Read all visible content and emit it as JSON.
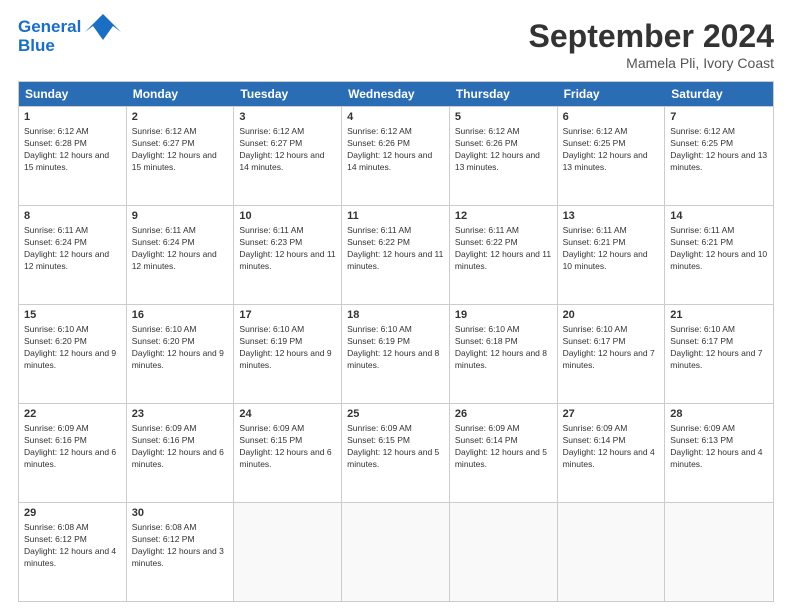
{
  "header": {
    "logo_line1": "General",
    "logo_line2": "Blue",
    "month": "September 2024",
    "location": "Mamela Pli, Ivory Coast"
  },
  "days_of_week": [
    "Sunday",
    "Monday",
    "Tuesday",
    "Wednesday",
    "Thursday",
    "Friday",
    "Saturday"
  ],
  "rows": [
    [
      {
        "day": "1",
        "rise": "6:12 AM",
        "set": "6:28 PM",
        "daylight": "12 hours and 15 minutes."
      },
      {
        "day": "2",
        "rise": "6:12 AM",
        "set": "6:27 PM",
        "daylight": "12 hours and 15 minutes."
      },
      {
        "day": "3",
        "rise": "6:12 AM",
        "set": "6:27 PM",
        "daylight": "12 hours and 14 minutes."
      },
      {
        "day": "4",
        "rise": "6:12 AM",
        "set": "6:26 PM",
        "daylight": "12 hours and 14 minutes."
      },
      {
        "day": "5",
        "rise": "6:12 AM",
        "set": "6:26 PM",
        "daylight": "12 hours and 13 minutes."
      },
      {
        "day": "6",
        "rise": "6:12 AM",
        "set": "6:25 PM",
        "daylight": "12 hours and 13 minutes."
      },
      {
        "day": "7",
        "rise": "6:12 AM",
        "set": "6:25 PM",
        "daylight": "12 hours and 13 minutes."
      }
    ],
    [
      {
        "day": "8",
        "rise": "6:11 AM",
        "set": "6:24 PM",
        "daylight": "12 hours and 12 minutes."
      },
      {
        "day": "9",
        "rise": "6:11 AM",
        "set": "6:24 PM",
        "daylight": "12 hours and 12 minutes."
      },
      {
        "day": "10",
        "rise": "6:11 AM",
        "set": "6:23 PM",
        "daylight": "12 hours and 11 minutes."
      },
      {
        "day": "11",
        "rise": "6:11 AM",
        "set": "6:22 PM",
        "daylight": "12 hours and 11 minutes."
      },
      {
        "day": "12",
        "rise": "6:11 AM",
        "set": "6:22 PM",
        "daylight": "12 hours and 11 minutes."
      },
      {
        "day": "13",
        "rise": "6:11 AM",
        "set": "6:21 PM",
        "daylight": "12 hours and 10 minutes."
      },
      {
        "day": "14",
        "rise": "6:11 AM",
        "set": "6:21 PM",
        "daylight": "12 hours and 10 minutes."
      }
    ],
    [
      {
        "day": "15",
        "rise": "6:10 AM",
        "set": "6:20 PM",
        "daylight": "12 hours and 9 minutes."
      },
      {
        "day": "16",
        "rise": "6:10 AM",
        "set": "6:20 PM",
        "daylight": "12 hours and 9 minutes."
      },
      {
        "day": "17",
        "rise": "6:10 AM",
        "set": "6:19 PM",
        "daylight": "12 hours and 9 minutes."
      },
      {
        "day": "18",
        "rise": "6:10 AM",
        "set": "6:19 PM",
        "daylight": "12 hours and 8 minutes."
      },
      {
        "day": "19",
        "rise": "6:10 AM",
        "set": "6:18 PM",
        "daylight": "12 hours and 8 minutes."
      },
      {
        "day": "20",
        "rise": "6:10 AM",
        "set": "6:17 PM",
        "daylight": "12 hours and 7 minutes."
      },
      {
        "day": "21",
        "rise": "6:10 AM",
        "set": "6:17 PM",
        "daylight": "12 hours and 7 minutes."
      }
    ],
    [
      {
        "day": "22",
        "rise": "6:09 AM",
        "set": "6:16 PM",
        "daylight": "12 hours and 6 minutes."
      },
      {
        "day": "23",
        "rise": "6:09 AM",
        "set": "6:16 PM",
        "daylight": "12 hours and 6 minutes."
      },
      {
        "day": "24",
        "rise": "6:09 AM",
        "set": "6:15 PM",
        "daylight": "12 hours and 6 minutes."
      },
      {
        "day": "25",
        "rise": "6:09 AM",
        "set": "6:15 PM",
        "daylight": "12 hours and 5 minutes."
      },
      {
        "day": "26",
        "rise": "6:09 AM",
        "set": "6:14 PM",
        "daylight": "12 hours and 5 minutes."
      },
      {
        "day": "27",
        "rise": "6:09 AM",
        "set": "6:14 PM",
        "daylight": "12 hours and 4 minutes."
      },
      {
        "day": "28",
        "rise": "6:09 AM",
        "set": "6:13 PM",
        "daylight": "12 hours and 4 minutes."
      }
    ],
    [
      {
        "day": "29",
        "rise": "6:08 AM",
        "set": "6:12 PM",
        "daylight": "12 hours and 4 minutes."
      },
      {
        "day": "30",
        "rise": "6:08 AM",
        "set": "6:12 PM",
        "daylight": "12 hours and 3 minutes."
      },
      {
        "day": "",
        "rise": "",
        "set": "",
        "daylight": ""
      },
      {
        "day": "",
        "rise": "",
        "set": "",
        "daylight": ""
      },
      {
        "day": "",
        "rise": "",
        "set": "",
        "daylight": ""
      },
      {
        "day": "",
        "rise": "",
        "set": "",
        "daylight": ""
      },
      {
        "day": "",
        "rise": "",
        "set": "",
        "daylight": ""
      }
    ]
  ]
}
